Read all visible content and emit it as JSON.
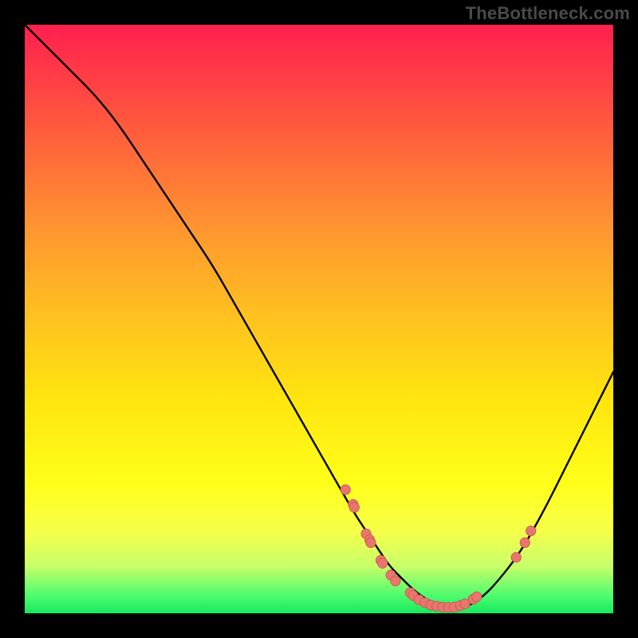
{
  "watermark": "TheBottleneck.com",
  "colors": {
    "page_bg": "#000000",
    "curve": "#000000",
    "marker_fill": "#e8766e",
    "marker_stroke": "#c5564f",
    "gradient_top": "#ff1f4f",
    "gradient_bottom": "#17e85e"
  },
  "chart_data": {
    "type": "line",
    "title": "",
    "xlabel": "",
    "ylabel": "",
    "xlim": [
      0,
      100
    ],
    "ylim": [
      0,
      100
    ],
    "grid": false,
    "legend": false,
    "series": [
      {
        "name": "bottleneck-curve",
        "x": [
          0,
          4,
          8,
          12,
          16,
          20,
          24,
          28,
          32,
          36,
          40,
          44,
          48,
          52,
          56,
          58,
          60,
          62,
          64,
          66,
          68,
          70,
          72,
          74,
          76,
          78,
          80,
          84,
          88,
          92,
          96,
          100
        ],
        "y": [
          100,
          96,
          92,
          88,
          83,
          77,
          71,
          65,
          59,
          52,
          45,
          38,
          31,
          24,
          17,
          14,
          11,
          8,
          6,
          4,
          2.5,
          1.5,
          1,
          1,
          1.5,
          3,
          5,
          10,
          17,
          25,
          33,
          41
        ]
      }
    ],
    "markers": [
      {
        "x": 54.5,
        "y": 21
      },
      {
        "x": 55.8,
        "y": 18.5
      },
      {
        "x": 56.0,
        "y": 18
      },
      {
        "x": 58.0,
        "y": 13.5
      },
      {
        "x": 58.6,
        "y": 12.5
      },
      {
        "x": 58.8,
        "y": 12
      },
      {
        "x": 60.5,
        "y": 9
      },
      {
        "x": 60.8,
        "y": 8.5
      },
      {
        "x": 62.2,
        "y": 6.5
      },
      {
        "x": 63.0,
        "y": 5.5
      },
      {
        "x": 65.5,
        "y": 3.5
      },
      {
        "x": 66.0,
        "y": 3
      },
      {
        "x": 67.0,
        "y": 2.3
      },
      {
        "x": 68.0,
        "y": 1.8
      },
      {
        "x": 69.0,
        "y": 1.4
      },
      {
        "x": 70.0,
        "y": 1.2
      },
      {
        "x": 71.0,
        "y": 1.05
      },
      {
        "x": 72.0,
        "y": 1.0
      },
      {
        "x": 73.0,
        "y": 1.05
      },
      {
        "x": 74.0,
        "y": 1.3
      },
      {
        "x": 74.8,
        "y": 1.6
      },
      {
        "x": 76.2,
        "y": 2.4
      },
      {
        "x": 76.8,
        "y": 2.8
      },
      {
        "x": 83.5,
        "y": 9.5
      },
      {
        "x": 85.0,
        "y": 12
      },
      {
        "x": 86.0,
        "y": 14
      }
    ]
  }
}
